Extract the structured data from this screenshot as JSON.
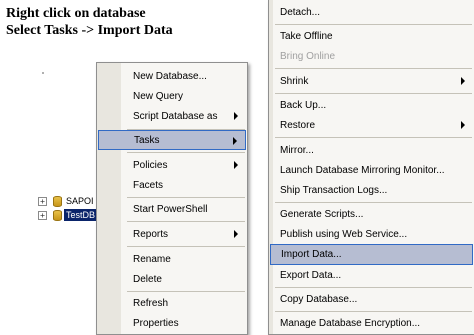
{
  "instructions": {
    "line1": "Right click on database",
    "line2": "Select Tasks -> Import Data"
  },
  "tree": {
    "items": [
      {
        "label": "SAPOI",
        "expander": "+"
      },
      {
        "label": "TestDB",
        "expander": "+"
      }
    ]
  },
  "context_menu": {
    "items": {
      "new_database": "New Database...",
      "new_query": "New Query",
      "script_database_as": "Script Database as",
      "tasks": "Tasks",
      "policies": "Policies",
      "facets": "Facets",
      "start_powershell": "Start PowerShell",
      "reports": "Reports",
      "rename": "Rename",
      "delete": "Delete",
      "refresh": "Refresh",
      "properties": "Properties"
    }
  },
  "tasks_submenu": {
    "items": {
      "detach": "Detach...",
      "take_offline": "Take Offline",
      "bring_online": "Bring Online",
      "shrink": "Shrink",
      "back_up": "Back Up...",
      "restore": "Restore",
      "mirror": "Mirror...",
      "launch_mirroring_monitor": "Launch Database Mirroring Monitor...",
      "ship_transaction_logs": "Ship Transaction Logs...",
      "generate_scripts": "Generate Scripts...",
      "publish_web_service": "Publish using Web Service...",
      "import_data": "Import Data...",
      "export_data": "Export Data...",
      "copy_database": "Copy Database...",
      "manage_encryption": "Manage Database Encryption..."
    }
  },
  "colors": {
    "highlight_bg": "#b6bdd2",
    "highlight_border": "#316ac5",
    "menu_bg": "#f7f6f3",
    "selected_tree_bg": "#0a246a"
  }
}
